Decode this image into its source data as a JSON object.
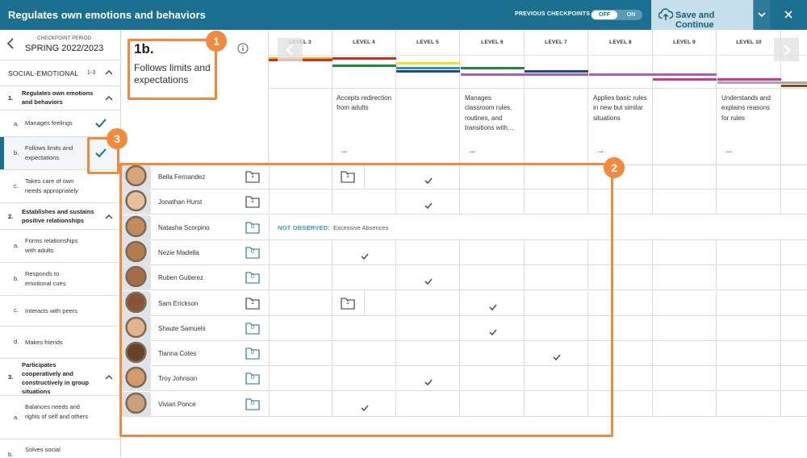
{
  "header": {
    "title": "Regulates own emotions and behaviors",
    "previous_checkpoints_label": "PREVIOUS CHECKPOINTS",
    "toggle_off": "OFF",
    "toggle_on": "ON",
    "save_label": "Save and Continue"
  },
  "sidebar": {
    "checkpoint_label": "CHECKPOINT PERIOD",
    "checkpoint_value": "SPRING 2022/2023",
    "section_title": "SOCIAL-EMOTIONAL",
    "section_range": "1-3",
    "items": [
      {
        "letter": "1.",
        "label": "Regulates own emotions and behaviors",
        "type": "group"
      },
      {
        "letter": "a.",
        "label": "Manages feelings",
        "type": "item",
        "checked": true
      },
      {
        "letter": "b.",
        "label": "Follows limits and expectations",
        "type": "item",
        "checked": true,
        "active": true
      },
      {
        "letter": "c.",
        "label": "Takes care of own needs appropriately",
        "type": "item"
      },
      {
        "letter": "2.",
        "label": "Establishes and sustains positive relationships",
        "type": "group"
      },
      {
        "letter": "a.",
        "label": "Forms relationships with adults",
        "type": "item"
      },
      {
        "letter": "b.",
        "label": "Responds to emotional cues",
        "type": "item"
      },
      {
        "letter": "c.",
        "label": "Interacts with peers",
        "type": "item"
      },
      {
        "letter": "d.",
        "label": "Makes friends",
        "type": "item"
      },
      {
        "letter": "3.",
        "label": "Participates cooperatively and constructively in group situations",
        "type": "group"
      },
      {
        "letter": "a.",
        "label": "Balances needs and rights of self and others",
        "type": "item"
      },
      {
        "letter": "b.",
        "label": "Solves social",
        "type": "item"
      }
    ]
  },
  "item": {
    "code": "1b.",
    "name": "Follows limits and expectations"
  },
  "levels": [
    {
      "label": "LEVEL 3",
      "desc": ""
    },
    {
      "label": "LEVEL 4",
      "desc": "Accepts redirection from adults",
      "more": "..."
    },
    {
      "label": "LEVEL 5",
      "desc": ""
    },
    {
      "label": "LEVEL 6",
      "desc": "Manages classroom rules, routines, and transitions with…",
      "more": "..."
    },
    {
      "label": "LEVEL 7",
      "desc": ""
    },
    {
      "label": "LEVEL 8",
      "desc": "Applies basic rules in new but similar situations",
      "more": "..."
    },
    {
      "label": "LEVEL 9",
      "desc": ""
    },
    {
      "label": "LEVEL 10",
      "desc": "Understands and explains reasons for rules",
      "more": "..."
    }
  ],
  "colors": {
    "accent": "#1b7092",
    "annotation": "#f28a3e",
    "check": "#555555"
  },
  "students": [
    {
      "name": "Bella Fernandez",
      "count": "1",
      "status": "observed",
      "marks": [
        {
          "level": 4,
          "kind": "folder",
          "count": "1"
        },
        {
          "level": 5,
          "kind": "check"
        }
      ]
    },
    {
      "name": "Jonathan Hurst",
      "count": "1",
      "status": "observed",
      "marks": [
        {
          "level": 5,
          "kind": "check"
        }
      ]
    },
    {
      "name": "Natasha Scorpino",
      "count": "0",
      "status": "not_observed",
      "not_observed_label": "NOT OBSERVED:",
      "not_observed_reason": "Excessive Absences",
      "marks": []
    },
    {
      "name": "Nezie Madella",
      "count": "0",
      "status": "observed",
      "marks": [
        {
          "level": 4,
          "kind": "check"
        }
      ]
    },
    {
      "name": "Ruben Gutierez",
      "count": "0",
      "status": "observed",
      "marks": [
        {
          "level": 5,
          "kind": "check"
        }
      ]
    },
    {
      "name": "Sam Erickson",
      "count": "1",
      "status": "observed",
      "marks": [
        {
          "level": 4,
          "kind": "folder",
          "count": "1"
        },
        {
          "level": 6,
          "kind": "check"
        }
      ]
    },
    {
      "name": "Shaute Samuels",
      "count": "0",
      "status": "observed",
      "marks": [
        {
          "level": 6,
          "kind": "check"
        }
      ]
    },
    {
      "name": "Tianna Cotes",
      "count": "0",
      "status": "observed",
      "marks": [
        {
          "level": 7,
          "kind": "check"
        }
      ]
    },
    {
      "name": "Troy Johnson",
      "count": "0",
      "status": "observed",
      "marks": [
        {
          "level": 5,
          "kind": "check"
        }
      ]
    },
    {
      "name": "Vivian Ponce",
      "count": "0",
      "status": "observed",
      "marks": [
        {
          "level": 4,
          "kind": "check"
        }
      ]
    }
  ],
  "annotations": [
    "1",
    "2",
    "3"
  ]
}
